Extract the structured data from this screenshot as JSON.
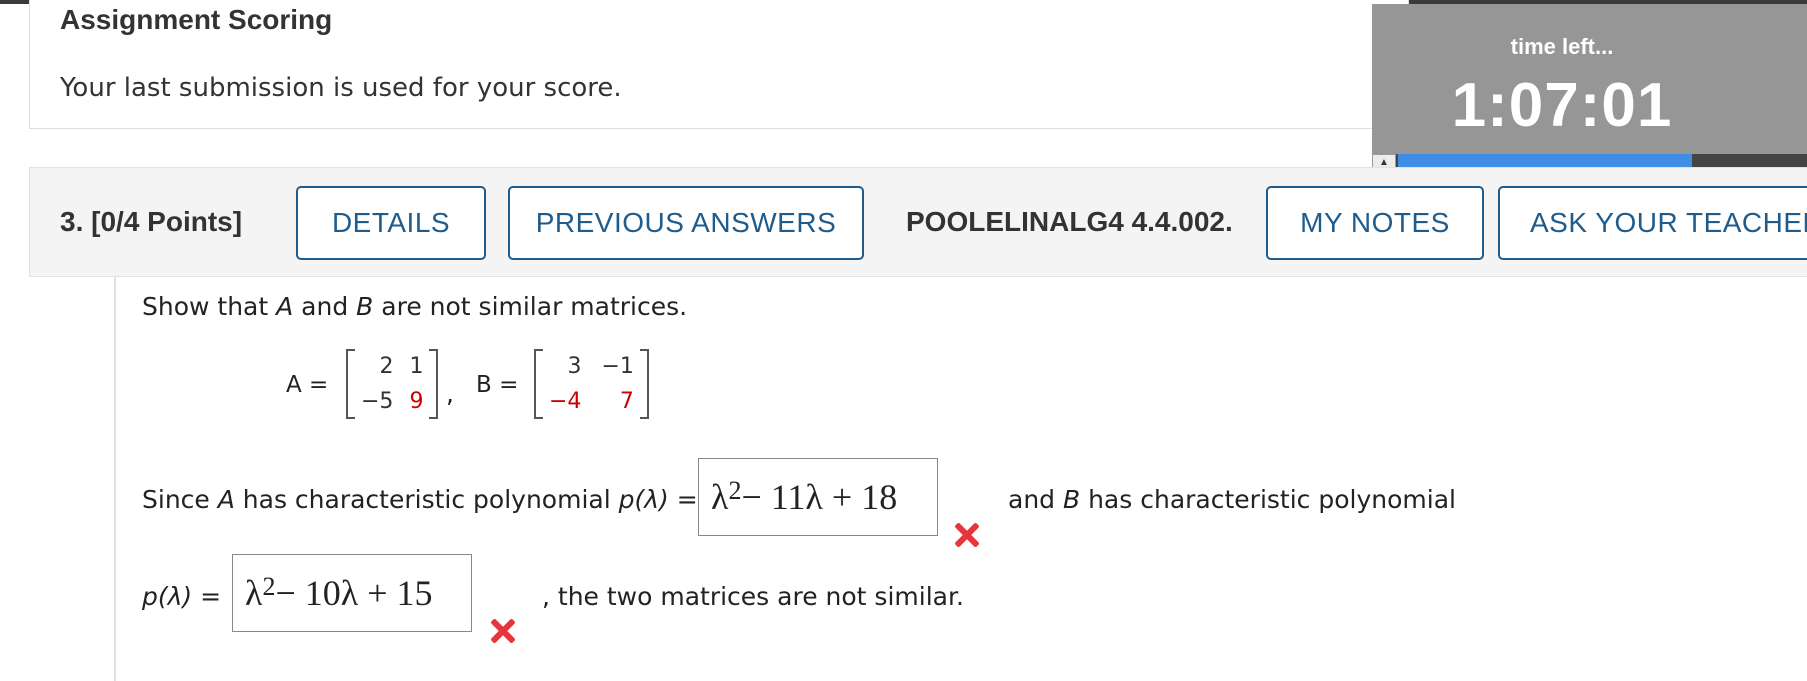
{
  "scoring": {
    "title": "Assignment Scoring",
    "note": "Your last submission is used for your score."
  },
  "timer": {
    "label": "time left...",
    "value": "1:07:01",
    "toggle_glyph": "▲",
    "progress_fraction": 0.72
  },
  "question": {
    "number": "3.",
    "points": "[0/4 Points]",
    "buttons": {
      "details": "DETAILS",
      "previous_answers": "PREVIOUS ANSWERS",
      "my_notes": "MY NOTES",
      "ask_teacher": "ASK YOUR TEACHER"
    },
    "code": "POOLELINALG4 4.4.002."
  },
  "body": {
    "prompt_pre": "Show that ",
    "prompt_a": "A",
    "prompt_and": " and ",
    "prompt_b": "B",
    "prompt_post": " are not similar matrices.",
    "matrix_a_label": "A =",
    "matrix_b_label": "B =",
    "comma": ",",
    "matrix_a": [
      "2",
      "1",
      "−5",
      "9"
    ],
    "matrix_b": [
      "3",
      "−1",
      "−4",
      "7"
    ],
    "since_pre": "Since ",
    "since_a": "A",
    "since_mid": " has characteristic polynomial ",
    "since_p": "p(λ) =",
    "answer1_main": "λ",
    "answer1_exp": "2",
    "answer1_rest": " − 11λ + 18",
    "and_pre": "and ",
    "and_b": "B",
    "and_post": " has characteristic polynomial",
    "p2": "p(λ) =",
    "answer2_main": "λ",
    "answer2_exp": "2",
    "answer2_rest": " − 10λ + 15",
    "conclusion": ", the two matrices are not similar.",
    "incorrect_icon": "x-mark-icon",
    "incorrect_color": "#e8343b"
  }
}
